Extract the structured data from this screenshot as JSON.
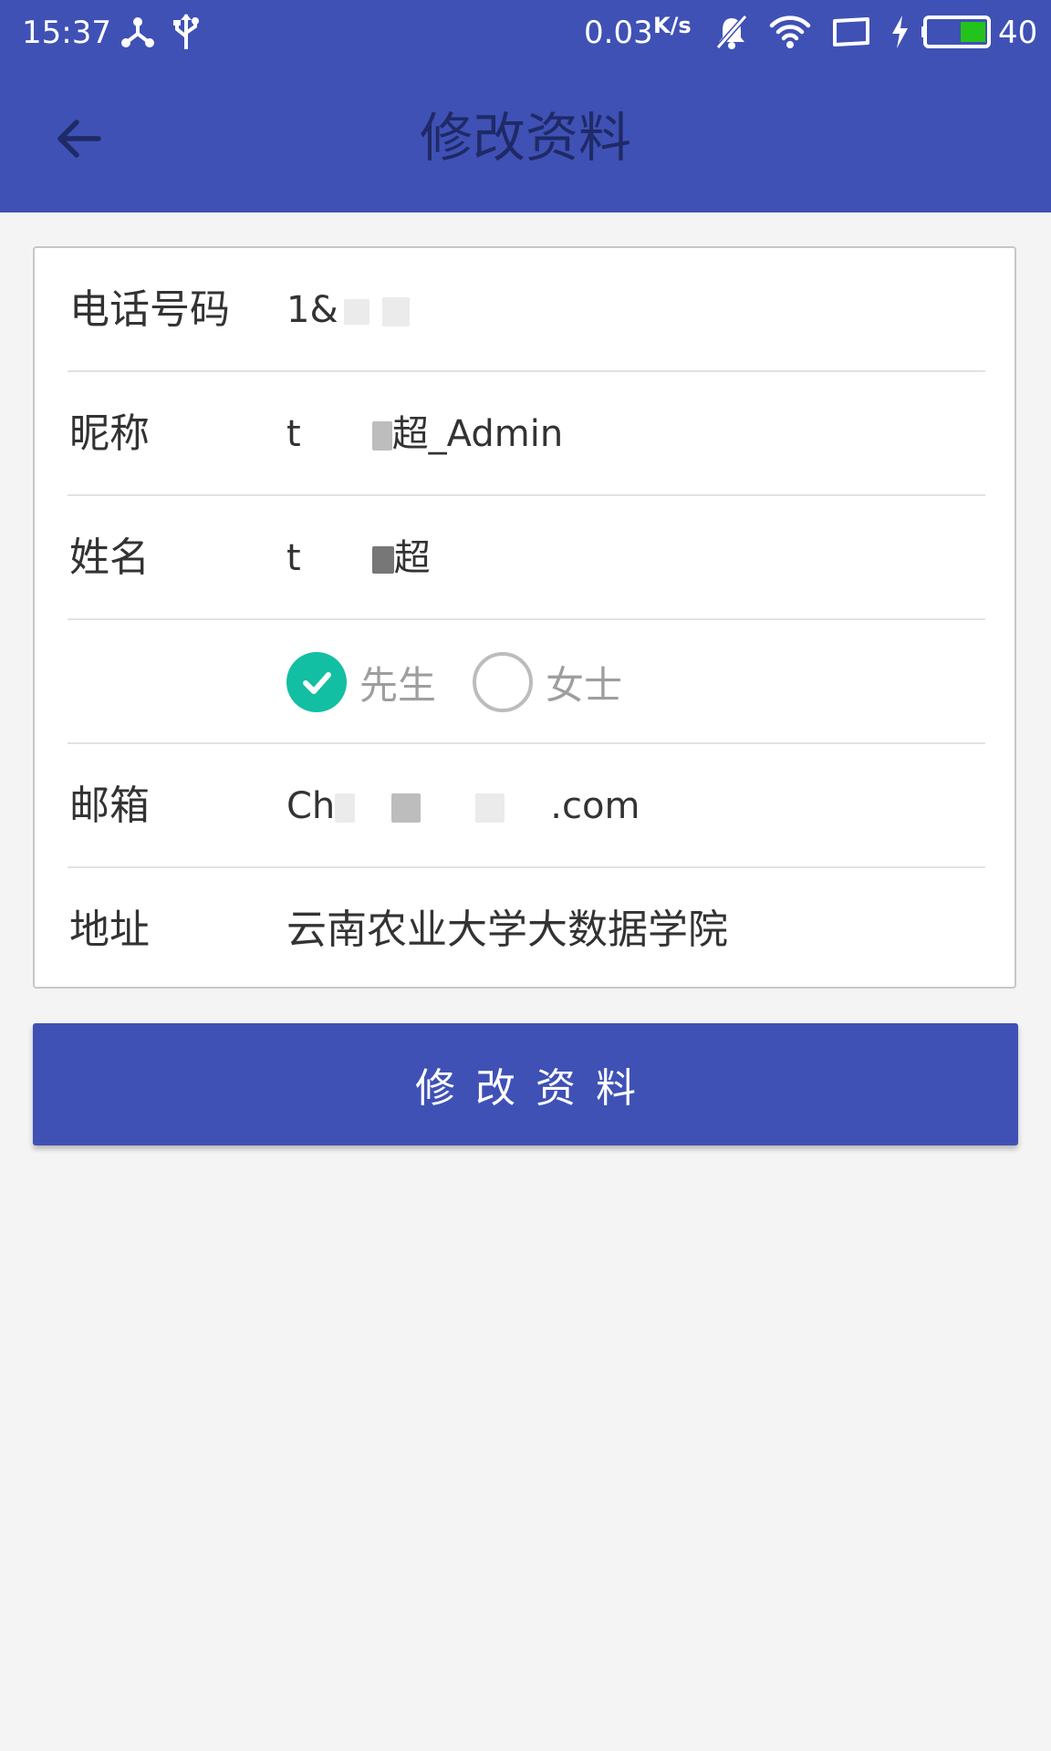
{
  "status_bar": {
    "time": "15:37",
    "network_speed": "0.03",
    "network_unit": "K/s",
    "battery_level": "40",
    "icons": [
      "usb-share-icon",
      "usb-icon",
      "mute-bell-icon",
      "wifi-icon",
      "screen-rotate-icon",
      "charging-icon",
      "battery-icon"
    ]
  },
  "app_bar": {
    "back_icon": "arrow-left-icon",
    "title": "修改资料"
  },
  "form": {
    "phone": {
      "label": "电话号码",
      "value": "1&"
    },
    "nickname": {
      "label": "昵称",
      "value_prefix": "t",
      "value_suffix": "超_Admin"
    },
    "name": {
      "label": "姓名",
      "value_prefix": "t",
      "value_suffix": "超"
    },
    "gender": {
      "options": [
        {
          "label": "先生",
          "selected": true
        },
        {
          "label": "女士",
          "selected": false
        }
      ]
    },
    "email": {
      "label": "邮箱",
      "value_prefix": "Ch",
      "value_suffix": ".com"
    },
    "address": {
      "label": "地址",
      "value": "云南农业大学大数据学院"
    }
  },
  "submit_button": {
    "label": "修改资料"
  },
  "colors": {
    "primary": "#3f51b5",
    "title_text": "#1f2a66",
    "radio_checked": "#12bfa2",
    "radio_unchecked": "#bcbcbc",
    "background": "#f4f4f4"
  }
}
